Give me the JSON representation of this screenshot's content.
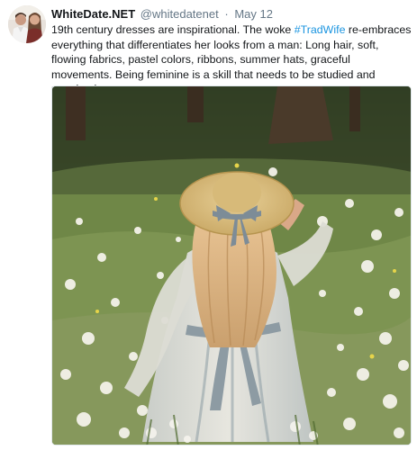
{
  "tweet": {
    "display_name": "WhiteDate.NET",
    "handle": "@whitedatenet",
    "separator": "·",
    "date": "May 12",
    "text_before": "19th century dresses are inspirational. The woke ",
    "hashtag": "#TradWife",
    "text_after": " re-embraces everything that differentiates her looks from a man: Long hair, soft, flowing fabrics, pastel colors, ribbons, summer hats, graceful movements. Being feminine is a skill that needs to be studied and practiced."
  },
  "colors": {
    "link": "#1b95e0",
    "text": "#14171a",
    "muted": "#657786"
  },
  "icons": {
    "avatar": "profile-photo",
    "media": "photo-woman-in-meadow"
  }
}
